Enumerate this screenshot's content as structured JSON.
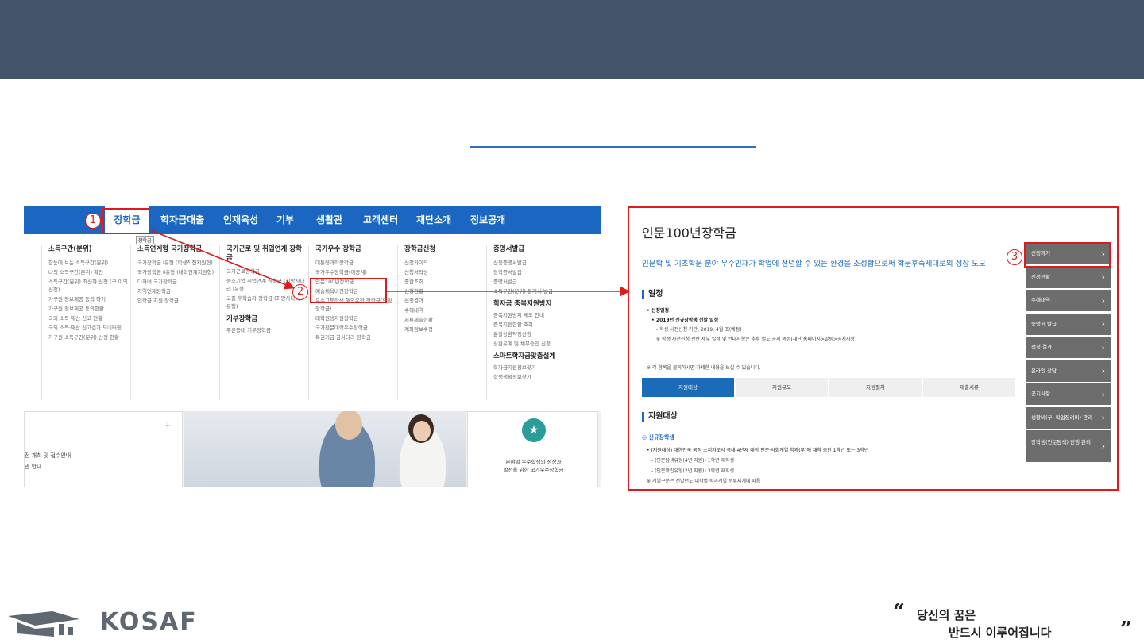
{
  "left": {
    "nav": [
      "장학금",
      "학자금대출",
      "인재육성",
      "기부",
      "생활관",
      "고객센터",
      "재단소개",
      "정보공개"
    ],
    "tooltip": "장학금",
    "columns": [
      {
        "head": "소득구간(분위)",
        "items": [
          "한눈에 보는 소득구간(분위)",
          "나의 소득구간(분위) 확인",
          "소득구간(분위) 최신화 신청 (구 이의신청)",
          "가구원 정보제공 동의 하기",
          "가구원 정보제공 동의현황",
          "국외 소득·재산 신고 현황",
          "국외 소득·재산 신고결과 모니터링",
          "가구원 소득구간(분위) 산정 현황"
        ]
      },
      {
        "head": "소득연계형 국가장학금",
        "items": [
          "국가장학금 Ⅰ유형 (학생직접지원형)",
          "국가장학금 Ⅱ유형 (대학연계지원형)",
          "다자녀 국가장학금",
          "지역인재장학금",
          "입학금 지원 장학금"
        ]
      },
      {
        "head": "국가근로 및 취업연계 장학금",
        "items": [
          "국가근로장학금",
          "중소기업 취업연계 장학금 (희망사다리 Ⅰ유형)",
          "고졸 후학습자 장학금 (희망사다리 Ⅱ유형)"
        ],
        "head2": "기부장학금",
        "items2": [
          "푸른등대 기부장학금"
        ]
      },
      {
        "head": "국가우수 장학금",
        "items": [
          "대통령과학장학금",
          "국가우수장학금(이공계)",
          "인문100년장학금",
          "예술체육비전장학금",
          "우수고등학생 해외유학 장학금(드림장학금)",
          "대학원생지원장학금",
          "국가전문대학우수장학금",
          "복권기금 꿈사다리 장학금"
        ]
      },
      {
        "head": "장학금신청",
        "items": [
          "신청가이드",
          "신청서작성",
          "종합조회",
          "신청현황",
          "선정결과",
          "수혜내역",
          "서류제출현황",
          "계좌정보수정"
        ]
      },
      {
        "head": "증명서발급",
        "items": [
          "신청증명서발급",
          "장학증서발급",
          "증명서발급",
          "소득구간(분위) 통지서 발급"
        ],
        "head2": "학자금 중복지원방지",
        "items2": [
          "중복지원방지 제도 안내",
          "중복지원현황 조회",
          "분할상환약정신청",
          "상환유예 및 채무승인 신청"
        ],
        "head3": "스마트학자금맞춤설계",
        "items3": [
          "학자금지원정보찾기",
          "학생생활정보찾기"
        ]
      }
    ],
    "info_lines": [
      "전 개최 및 접수안내",
      "관 안내"
    ],
    "plus": "+",
    "badge_icon": "★",
    "card_lines": [
      "분야별 우수학생의 성장과",
      "발전을 위한 국가우수장학금"
    ]
  },
  "callouts": [
    "1",
    "2",
    "3"
  ],
  "right": {
    "title": "인문100년장학금",
    "intro": "인문학 및 기초학문 분야 우수인재가 학업에 전념할 수 있는 환경을 조성함으로써 학문후속세대로의 성장 도모",
    "sec1": "일정",
    "s1": "• 선정일정",
    "s2": "• 2019년 신규장학생 선발 일정",
    "s3": "- 학생 사전신청 기간: 2019. 4월 초(예정)",
    "s4": "※ 학생 사전신청 관련 세부 일정 및 안내사항은 추후 별도 공지 예정(재단 홈페이지>알림>공지사항)",
    "s5": "※ 각 항목을 클릭하시면 자세한 내용을 보실 수 있습니다.",
    "tabs": [
      "지원대상",
      "지원규모",
      "지원절차",
      "제출서류"
    ],
    "sec2": "지원대상",
    "sub": "◎ 신규장학생",
    "t1": "• (지원대상) 대한민국 국적 소지자로서 국내 4년제 대학 인문·사회계열 학과(부)에 재학 중인 1학년 또는 3학년",
    "t2": "- (인문탐색유형(4년 지원)) 1학년 재학생",
    "t3": "- (인문확립유형(2년 지원)) 3학년 재학생",
    "t4": "※ 계열구분은 선발년도 대학별 학과계열 분류체계에 따름",
    "side": [
      "신청하기",
      "신청현황",
      "수혜내역",
      "증명서 발급",
      "선정 결과",
      "온라인 상담",
      "공지사항",
      "생활비(구. 학업장려비) 관리",
      "장학생(인문탐색) 진행 관리"
    ],
    "chev": "›"
  },
  "footer": {
    "logo": "KOSAF",
    "quote_open": "“",
    "quote_close": "”",
    "line1": "당신의 꿈은",
    "line2": "반드시 이루어집니다"
  },
  "colors": {
    "band": "#44546a",
    "nav": "#1a66c0",
    "highlight": "#e0191c",
    "tab_active": "#1a6bb8",
    "side": "#6d6d6d"
  }
}
